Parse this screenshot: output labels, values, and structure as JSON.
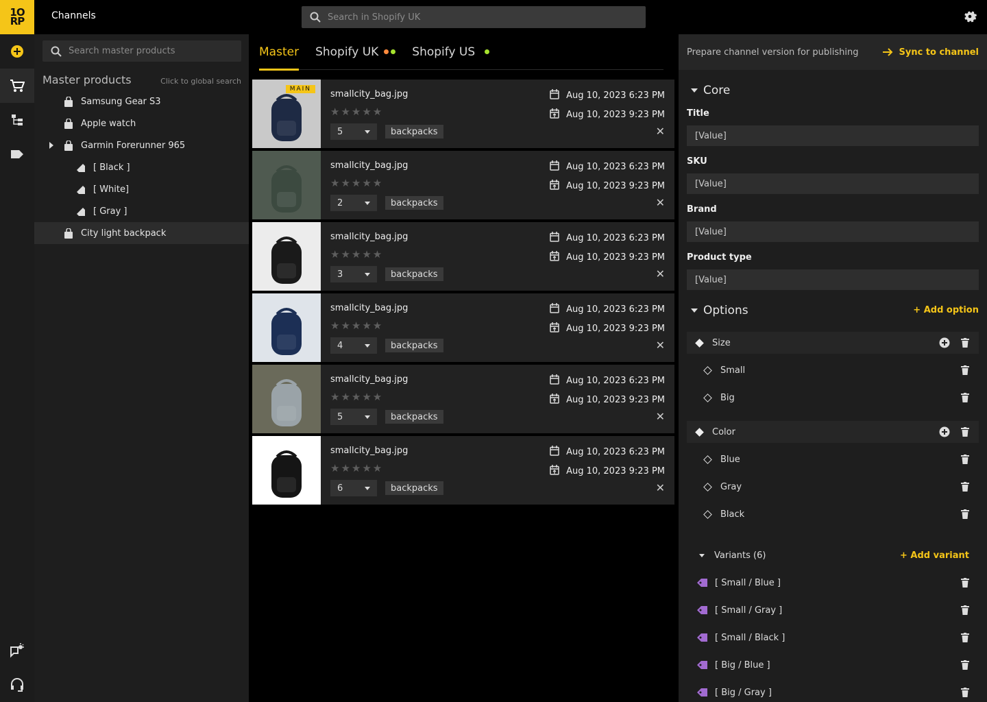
{
  "topbar": {
    "title": "Channels",
    "search_placeholder": "Search in Shopify UK"
  },
  "colors": {
    "accent": "#f5c518",
    "dot_orange": "#ff8a3d",
    "dot_green": "#a6e22e",
    "variant_tag": "#a26bd1"
  },
  "left": {
    "search_placeholder": "Search master products",
    "heading": "Master products",
    "hint": "Click to global search",
    "items": [
      {
        "label": "Samsung Gear S3"
      },
      {
        "label": "Apple watch"
      },
      {
        "label": "Garmin Forerunner 965"
      },
      {
        "label": "[ Black ]"
      },
      {
        "label": "[ White]"
      },
      {
        "label": "[ Gray ]"
      },
      {
        "label": "City light backpack"
      }
    ]
  },
  "tabs": [
    {
      "label": "Master"
    },
    {
      "label": "Shopify UK"
    },
    {
      "label": "Shopify US"
    }
  ],
  "rows": [
    {
      "file": "smallcity_bag.jpg",
      "qty": "5",
      "category": "backpacks",
      "created": "Aug 10, 2023 6:23 PM",
      "updated": "Aug 10, 2023 9:23 PM",
      "badge": "MAIN",
      "stars": "★★★★★"
    },
    {
      "file": "smallcity_bag.jpg",
      "qty": "2",
      "category": "backpacks",
      "created": "Aug 10, 2023 6:23 PM",
      "updated": "Aug 10, 2023 9:23 PM",
      "stars": "★★★★★"
    },
    {
      "file": "smallcity_bag.jpg",
      "qty": "3",
      "category": "backpacks",
      "created": "Aug 10, 2023 6:23 PM",
      "updated": "Aug 10, 2023 9:23 PM",
      "stars": "★★★★★"
    },
    {
      "file": "smallcity_bag.jpg",
      "qty": "4",
      "category": "backpacks",
      "created": "Aug 10, 2023 6:23 PM",
      "updated": "Aug 10, 2023 9:23 PM",
      "stars": "★★★★★"
    },
    {
      "file": "smallcity_bag.jpg",
      "qty": "5",
      "category": "backpacks",
      "created": "Aug 10, 2023 6:23 PM",
      "updated": "Aug 10, 2023 9:23 PM",
      "stars": "★★★★★"
    },
    {
      "file": "smallcity_bag.jpg",
      "qty": "6",
      "category": "backpacks",
      "created": "Aug 10, 2023 6:23 PM",
      "updated": "Aug 10, 2023 9:23 PM",
      "stars": "★★★★★"
    }
  ],
  "right": {
    "prepare": "Prepare channel version for publishing",
    "sync": "Sync to channel",
    "core": "Core",
    "fields": [
      {
        "label": "Title",
        "value": "[Value]"
      },
      {
        "label": "SKU",
        "value": "[Value]"
      },
      {
        "label": "Brand",
        "value": "[Value]"
      },
      {
        "label": "Product type",
        "value": "[Value]"
      }
    ],
    "options_title": "Options",
    "add_option": "+ Add option",
    "options": [
      {
        "name": "Size",
        "values": [
          "Small",
          "Big"
        ]
      },
      {
        "name": "Color",
        "values": [
          "Blue",
          "Gray",
          "Black"
        ]
      }
    ],
    "variants_title": "Variants (6)",
    "add_variant": "+ Add variant",
    "variants": [
      "[ Small / Blue ]",
      "[ Small / Gray ]",
      "[ Small / Black ]",
      "[ Big / Blue ]",
      "[ Big / Gray ]"
    ]
  }
}
